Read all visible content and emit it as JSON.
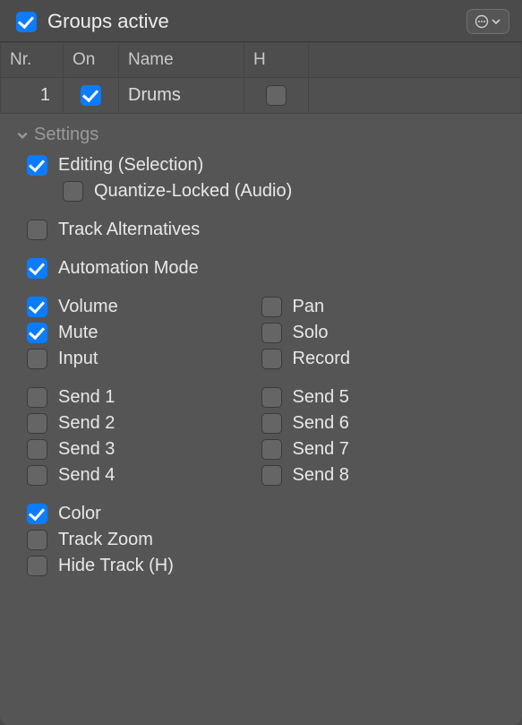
{
  "header": {
    "title": "Groups active",
    "groups_active_checked": true
  },
  "table": {
    "headers": {
      "nr": "Nr.",
      "on": "On",
      "name": "Name",
      "h": "H"
    },
    "rows": [
      {
        "nr": "1",
        "on": true,
        "name": "Drums",
        "h": false
      }
    ]
  },
  "settings": {
    "title": "Settings",
    "editing": {
      "label": "Editing (Selection)",
      "checked": true
    },
    "quantize": {
      "label": "Quantize-Locked (Audio)",
      "checked": false
    },
    "track_alt": {
      "label": "Track Alternatives",
      "checked": false
    },
    "automation": {
      "label": "Automation Mode",
      "checked": true
    },
    "vol": {
      "label": "Volume",
      "checked": true
    },
    "pan": {
      "label": "Pan",
      "checked": false
    },
    "mute": {
      "label": "Mute",
      "checked": true
    },
    "solo": {
      "label": "Solo",
      "checked": false
    },
    "input": {
      "label": "Input",
      "checked": false
    },
    "record": {
      "label": "Record",
      "checked": false
    },
    "send1": {
      "label": "Send 1",
      "checked": false
    },
    "send2": {
      "label": "Send 2",
      "checked": false
    },
    "send3": {
      "label": "Send 3",
      "checked": false
    },
    "send4": {
      "label": "Send 4",
      "checked": false
    },
    "send5": {
      "label": "Send 5",
      "checked": false
    },
    "send6": {
      "label": "Send 6",
      "checked": false
    },
    "send7": {
      "label": "Send 7",
      "checked": false
    },
    "send8": {
      "label": "Send 8",
      "checked": false
    },
    "color": {
      "label": "Color",
      "checked": true
    },
    "zoom": {
      "label": "Track Zoom",
      "checked": false
    },
    "hide": {
      "label": "Hide Track (H)",
      "checked": false
    }
  }
}
